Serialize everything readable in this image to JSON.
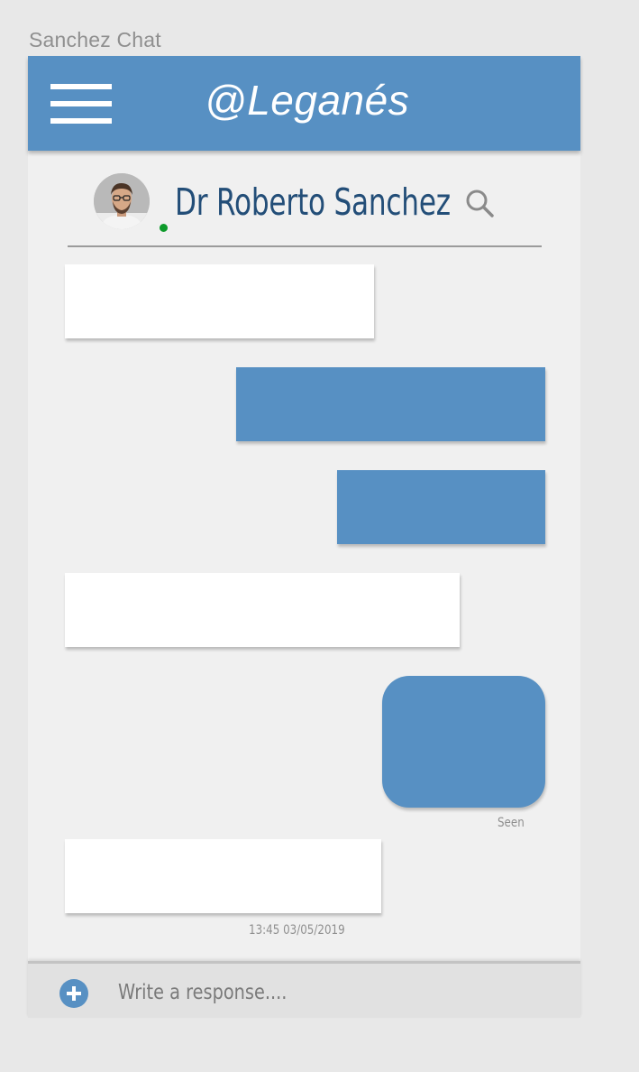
{
  "frame": {
    "label": "Sanchez Chat"
  },
  "header": {
    "title": "@Leganés",
    "menu_icon": "hamburger-menu-icon"
  },
  "contact": {
    "name": "Dr Roberto Sanchez",
    "status": "online",
    "status_color": "#0d9a2a",
    "search_icon": "search-icon"
  },
  "messages": [
    {
      "direction": "incoming",
      "text": ""
    },
    {
      "direction": "outgoing",
      "text": ""
    },
    {
      "direction": "outgoing",
      "text": ""
    },
    {
      "direction": "incoming",
      "text": ""
    },
    {
      "direction": "outgoing",
      "text": "",
      "receipt": "Seen"
    },
    {
      "direction": "incoming",
      "text": "",
      "timestamp": "13:45 03/05/2019"
    }
  ],
  "composer": {
    "placeholder": "Write a response....",
    "value": "",
    "add_icon": "plus-icon"
  },
  "colors": {
    "accent": "#5790c3",
    "contact_name": "#234e78",
    "background": "#f0f0f0",
    "incoming_bubble": "#ffffff",
    "outgoing_bubble": "#5790c3"
  }
}
